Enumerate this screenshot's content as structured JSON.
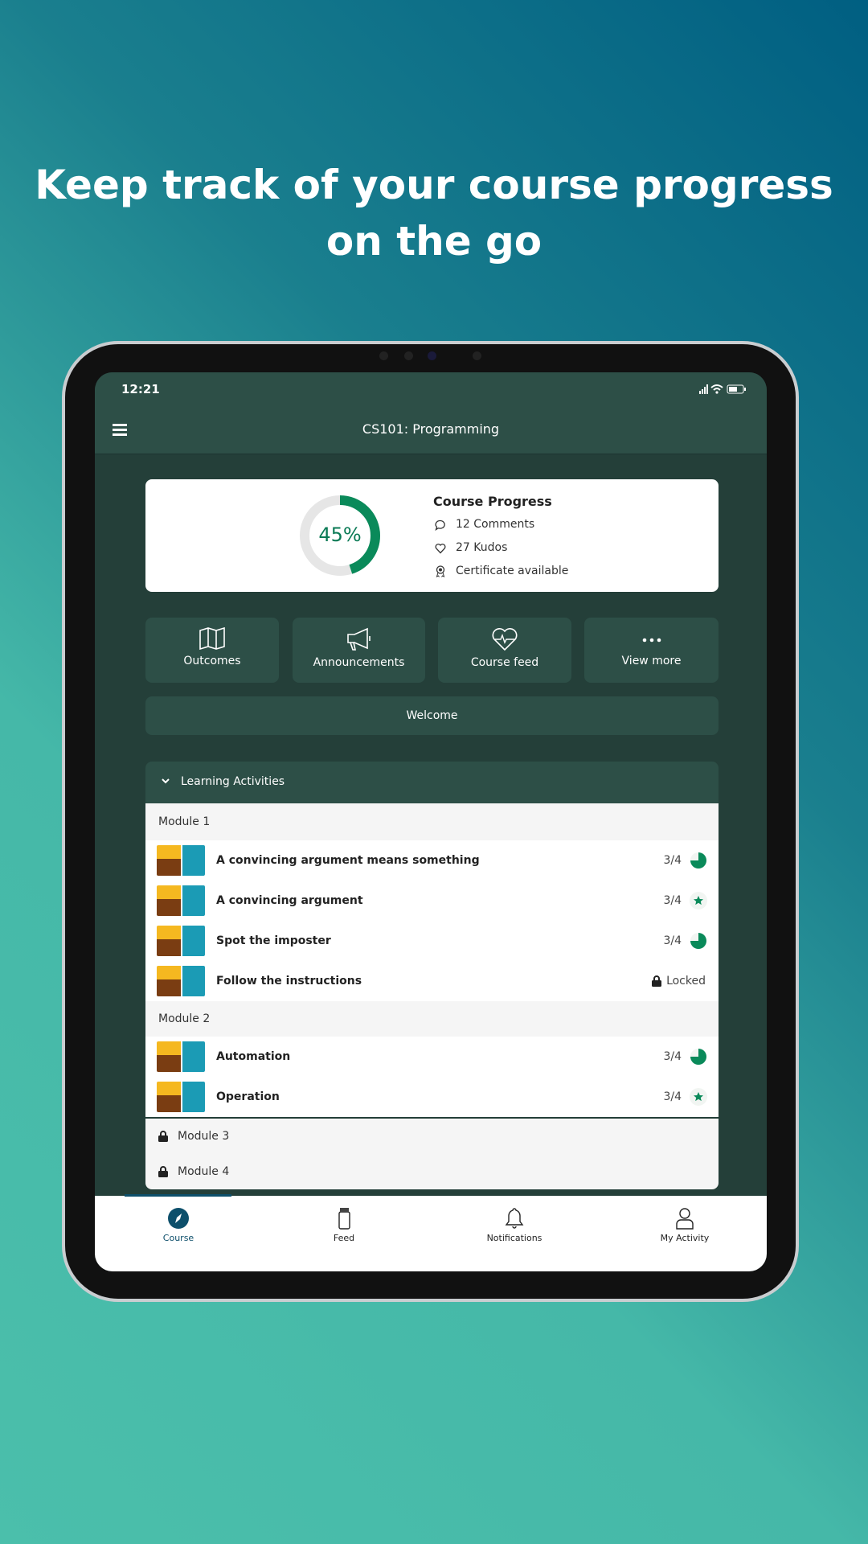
{
  "headline": {
    "line1": "Keep track of your course progress",
    "line2": "on the go"
  },
  "status_bar": {
    "time": "12:21"
  },
  "app_bar": {
    "title": "CS101: Programming",
    "menu_icon": "hamburger-icon"
  },
  "progress_card": {
    "percent": 45,
    "percent_label": "45%",
    "title": "Course Progress",
    "comments": "12 Comments",
    "kudos": "27 Kudos",
    "certificate": "Certificate available",
    "accent": "#0a8a5a"
  },
  "tiles": [
    {
      "label": "Outcomes",
      "icon": "map-icon"
    },
    {
      "label": "Announcements",
      "icon": "megaphone-icon"
    },
    {
      "label": "Course feed",
      "icon": "heart-pulse-icon"
    },
    {
      "label": "View more",
      "icon": "more-icon"
    }
  ],
  "welcome": "Welcome",
  "learning": {
    "header": "Learning Activities",
    "module1": "Module 1",
    "m1_items": [
      {
        "title": "A convincing argument means something",
        "progress": "3/4",
        "status": "partial"
      },
      {
        "title": "A convincing argument",
        "progress": "3/4",
        "status": "star"
      },
      {
        "title": "Spot the imposter",
        "progress": "3/4",
        "status": "partial"
      },
      {
        "title": "Follow the instructions",
        "status": "locked",
        "locked_label": "Locked"
      }
    ],
    "module2": "Module 2",
    "m2_items": [
      {
        "title": "Automation",
        "progress": "3/4",
        "status": "partial"
      },
      {
        "title": "Operation",
        "progress": "3/4",
        "status": "star"
      }
    ],
    "module3": "Module 3",
    "module4": "Module 4"
  },
  "nav": [
    {
      "label": "Course",
      "active": true
    },
    {
      "label": "Feed"
    },
    {
      "label": "Notifications"
    },
    {
      "label": "My Activity"
    }
  ],
  "colors": {
    "active_nav": "#0d4f6b",
    "app_bg": "#243f39",
    "bar": "#2d4f47"
  }
}
